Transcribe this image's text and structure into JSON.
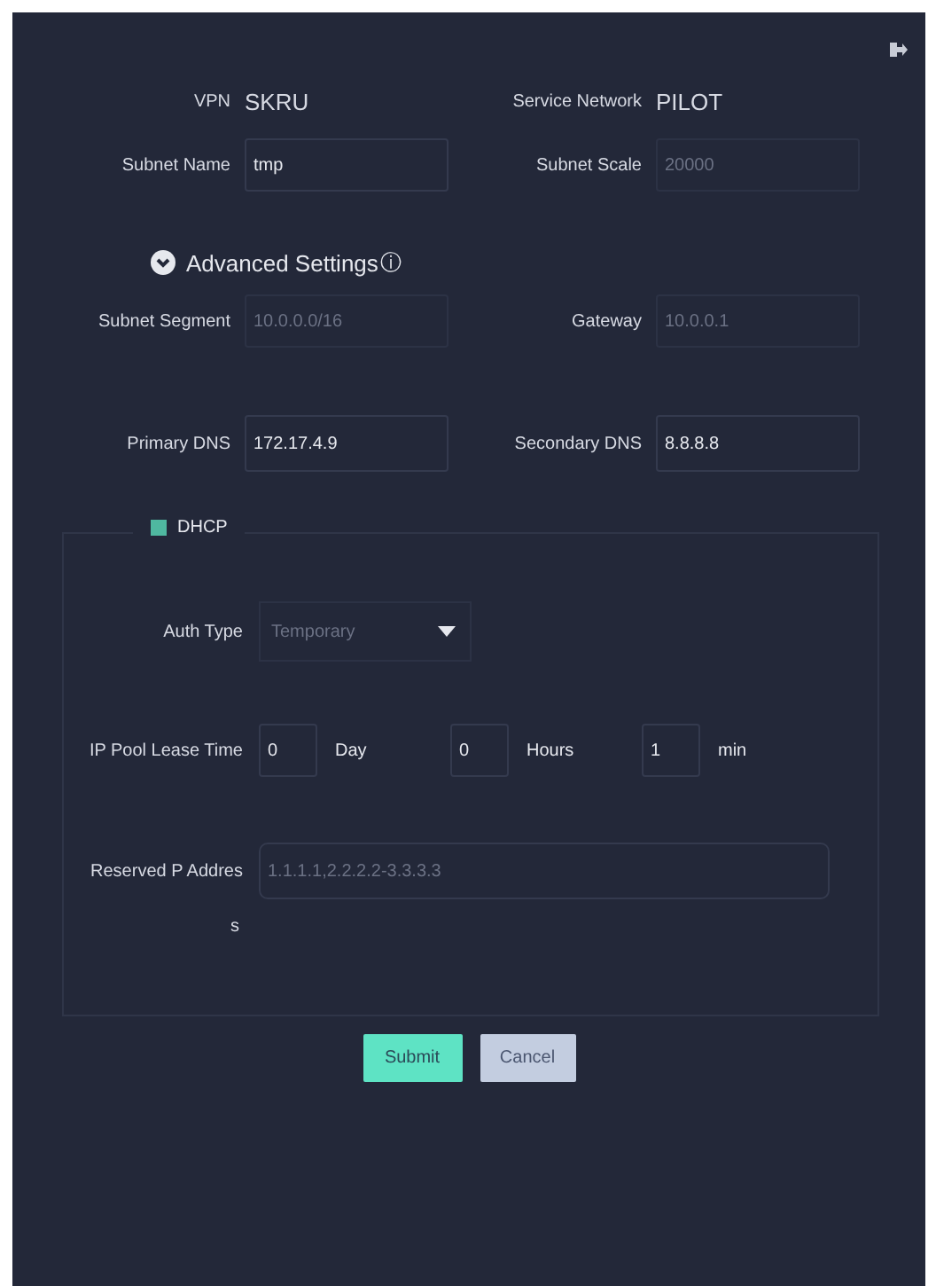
{
  "info": [
    {
      "label": "VPN",
      "value": "SKRU"
    },
    {
      "label": "Service Network",
      "value": "PILOT"
    }
  ],
  "subnet_fields": [
    {
      "label": "Subnet Name",
      "value": "tmp",
      "disabled": false
    },
    {
      "label": "Subnet Scale",
      "value": "20000",
      "disabled": true
    }
  ],
  "advanced": {
    "label": "Advanced Settings",
    "info": "ⓘ",
    "expanded": true
  },
  "segment_fields": [
    {
      "label": "Subnet Segment",
      "value": "10.0.0.0/16",
      "disabled": true
    },
    {
      "label": "Gateway",
      "value": "10.0.0.1",
      "disabled": true
    }
  ],
  "dns_fields": [
    {
      "label": "Primary DNS",
      "value": "172.17.4.9",
      "disabled": false
    },
    {
      "label": "Secondary DNS",
      "value": "8.8.8.8",
      "disabled": false
    }
  ],
  "dhcp": {
    "label": "DHCP",
    "checked": true,
    "auth_type": {
      "label": "Auth Type",
      "value": "Temporary"
    },
    "lease": {
      "label": "IP Pool Lease Time",
      "parts": [
        {
          "value": "0",
          "unit": "Day"
        },
        {
          "value": "0",
          "unit": "Hours"
        },
        {
          "value": "1",
          "unit": "min"
        }
      ]
    },
    "reserved": {
      "label_lines": [
        "Reserved P Addres",
        "s"
      ],
      "placeholder": "1.1.1.1,2.2.2.2-3.3.3.3"
    }
  },
  "buttons": [
    {
      "label": "Submit",
      "kind": "primary"
    },
    {
      "label": "Cancel",
      "kind": "secondary"
    }
  ]
}
